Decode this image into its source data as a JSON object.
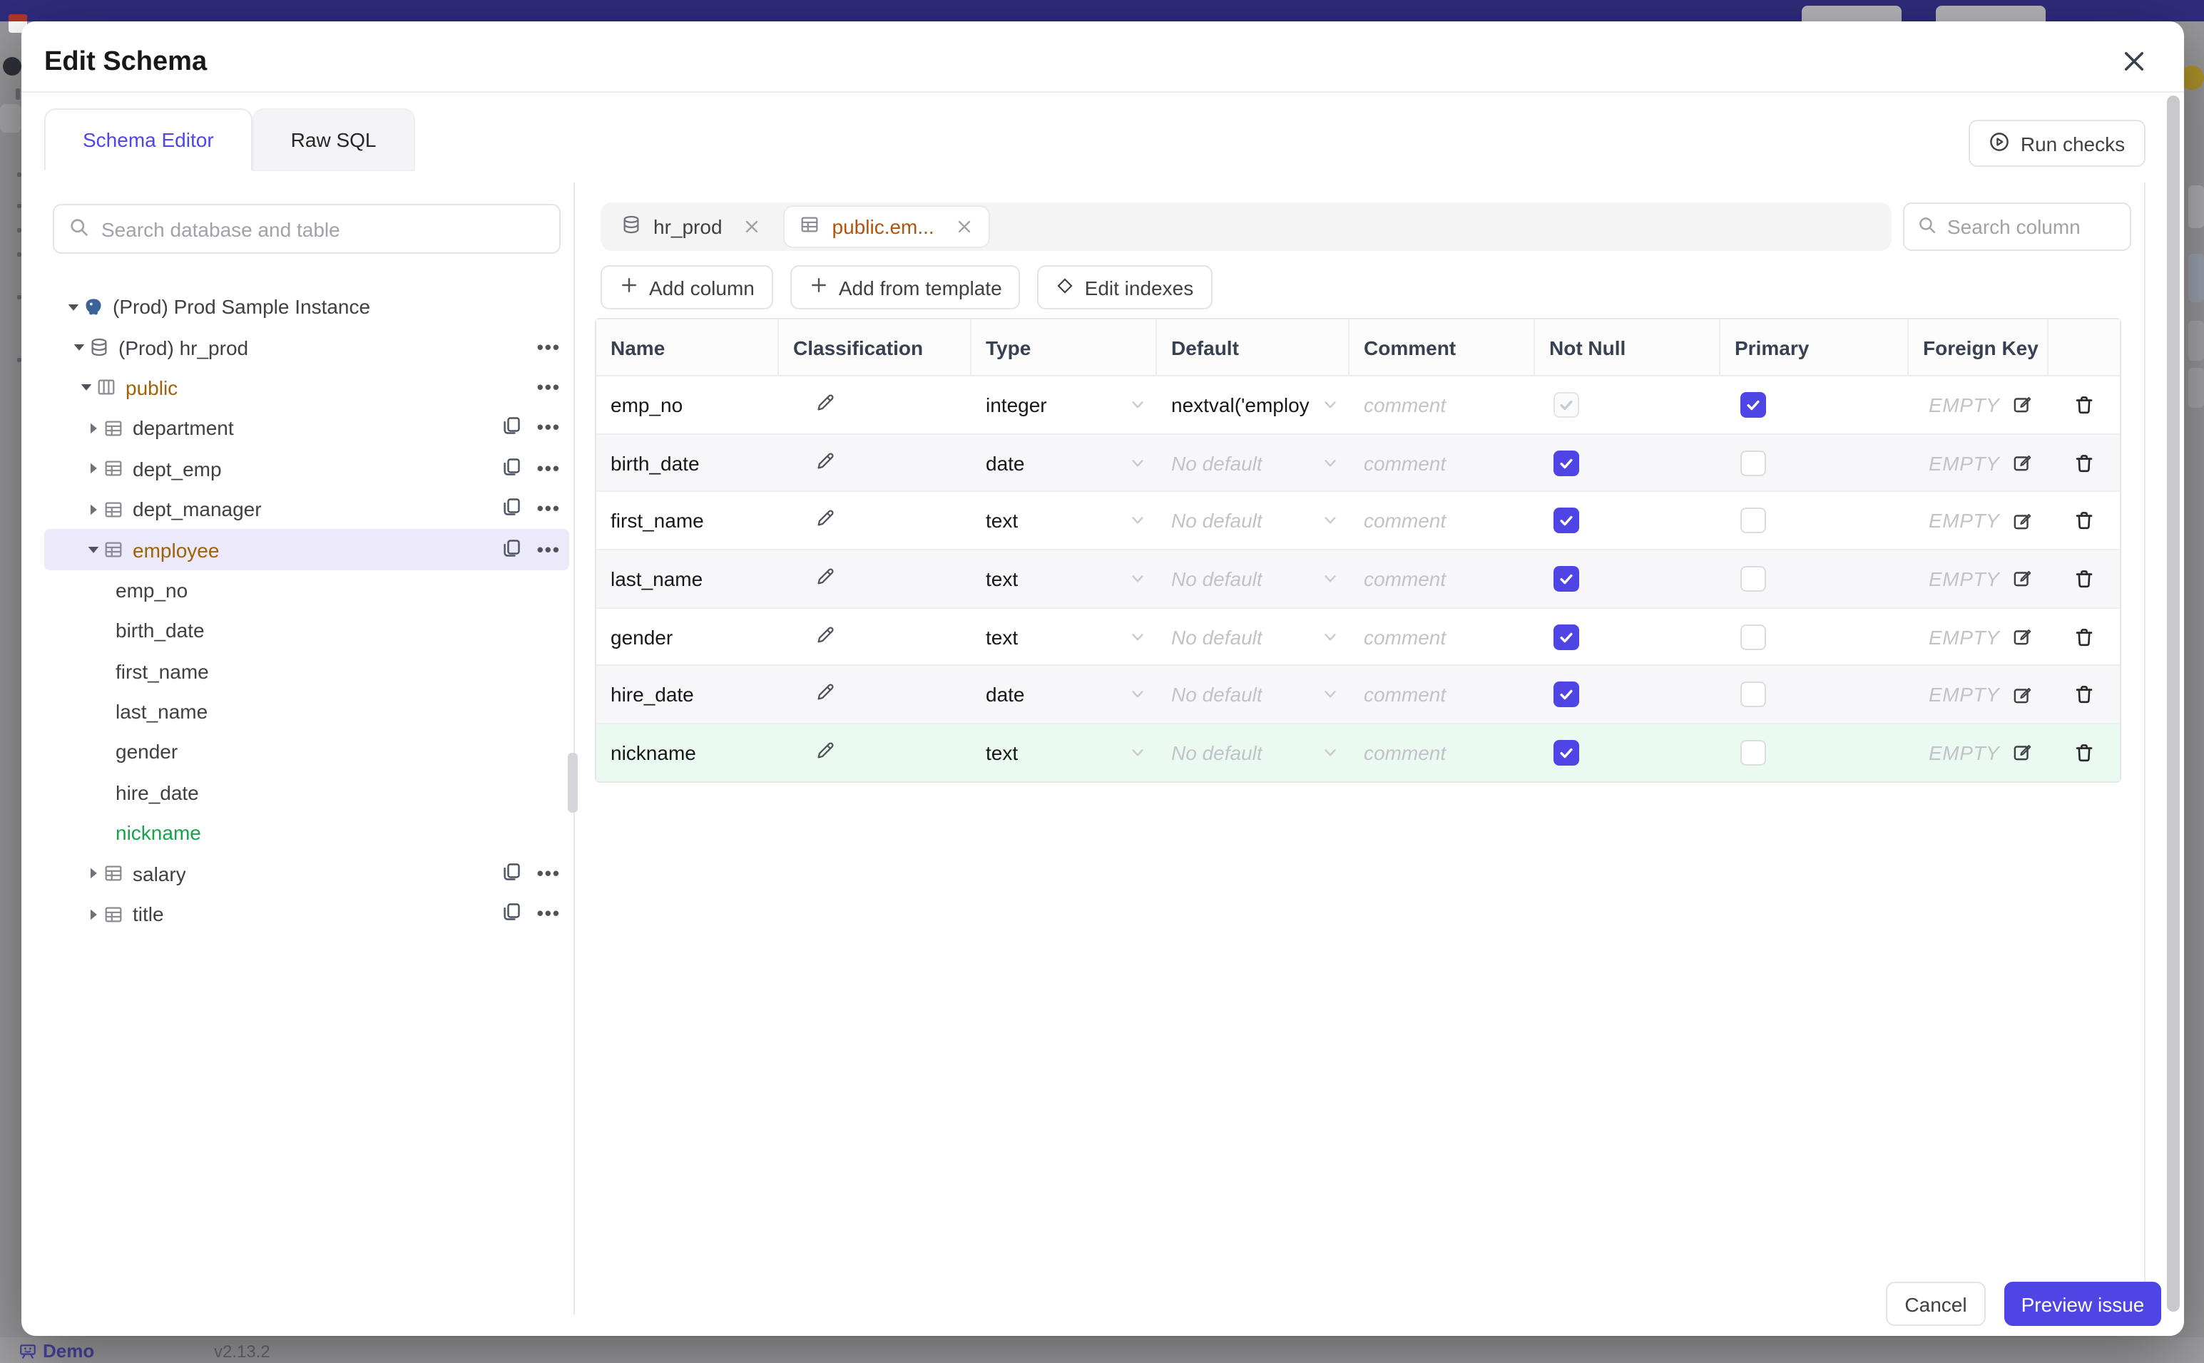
{
  "backdrop": {
    "demo_label": "Demo",
    "version": "v2.13.2"
  },
  "dialog": {
    "title": "Edit Schema",
    "close_icon": "close-icon",
    "tabs": [
      {
        "label": "Schema Editor",
        "active": true
      },
      {
        "label": "Raw SQL",
        "active": false
      }
    ],
    "run_checks_label": "Run checks",
    "sidebar": {
      "search_placeholder": "Search database and table",
      "tree": [
        {
          "level": 0,
          "caret": "down",
          "icon": "postgres",
          "label": "(Prod) Prod Sample Instance",
          "color": null,
          "selected": false,
          "copy": false,
          "menu": false
        },
        {
          "level": 1,
          "caret": "down",
          "icon": "database",
          "label": "(Prod) hr_prod",
          "color": null,
          "selected": false,
          "copy": false,
          "menu": true
        },
        {
          "level": 2,
          "caret": "down",
          "icon": "schema",
          "label": "public",
          "color": "amber",
          "selected": false,
          "copy": false,
          "menu": true
        },
        {
          "level": 3,
          "caret": "right",
          "icon": "table",
          "label": "department",
          "color": null,
          "selected": false,
          "copy": true,
          "menu": true
        },
        {
          "level": 3,
          "caret": "right",
          "icon": "table",
          "label": "dept_emp",
          "color": null,
          "selected": false,
          "copy": true,
          "menu": true
        },
        {
          "level": 3,
          "caret": "right",
          "icon": "table",
          "label": "dept_manager",
          "color": null,
          "selected": false,
          "copy": true,
          "menu": true
        },
        {
          "level": 3,
          "caret": "down",
          "icon": "table",
          "label": "employee",
          "color": "amber",
          "selected": true,
          "copy": true,
          "menu": true
        },
        {
          "level": 4,
          "caret": null,
          "icon": null,
          "label": "emp_no",
          "color": null,
          "selected": false,
          "copy": false,
          "menu": false
        },
        {
          "level": 4,
          "caret": null,
          "icon": null,
          "label": "birth_date",
          "color": null,
          "selected": false,
          "copy": false,
          "menu": false
        },
        {
          "level": 4,
          "caret": null,
          "icon": null,
          "label": "first_name",
          "color": null,
          "selected": false,
          "copy": false,
          "menu": false
        },
        {
          "level": 4,
          "caret": null,
          "icon": null,
          "label": "last_name",
          "color": null,
          "selected": false,
          "copy": false,
          "menu": false
        },
        {
          "level": 4,
          "caret": null,
          "icon": null,
          "label": "gender",
          "color": null,
          "selected": false,
          "copy": false,
          "menu": false
        },
        {
          "level": 4,
          "caret": null,
          "icon": null,
          "label": "hire_date",
          "color": null,
          "selected": false,
          "copy": false,
          "menu": false
        },
        {
          "level": 4,
          "caret": null,
          "icon": null,
          "label": "nickname",
          "color": "green",
          "selected": false,
          "copy": false,
          "menu": false
        },
        {
          "level": 3,
          "caret": "right",
          "icon": "table",
          "label": "salary",
          "color": null,
          "selected": false,
          "copy": true,
          "menu": true
        },
        {
          "level": 3,
          "caret": "right",
          "icon": "table",
          "label": "title",
          "color": null,
          "selected": false,
          "copy": true,
          "menu": true
        }
      ]
    },
    "editor": {
      "chips": [
        {
          "label": "hr_prod",
          "icon": "database",
          "active": false,
          "color": null
        },
        {
          "label": "public.em...",
          "icon": "table",
          "active": true,
          "color": "amber"
        }
      ],
      "column_search_placeholder": "Search column",
      "toolbar": [
        {
          "label": "Add column",
          "icon": "plus"
        },
        {
          "label": "Add from template",
          "icon": "plus"
        },
        {
          "label": "Edit indexes",
          "icon": "diamond"
        }
      ],
      "grid": {
        "headers": [
          "Name",
          "Classification",
          "Type",
          "Default",
          "Comment",
          "Not Null",
          "Primary",
          "Foreign Key",
          ""
        ],
        "comment_placeholder": "comment",
        "no_default_placeholder": "No default",
        "fk_empty_label": "EMPTY",
        "columns": [
          {
            "name": "emp_no",
            "type": "integer",
            "default": "nextval('employ",
            "default_is_placeholder": false,
            "not_null_checked": true,
            "not_null_disabled": true,
            "primary": true,
            "highlight": null
          },
          {
            "name": "birth_date",
            "type": "date",
            "default": "No default",
            "default_is_placeholder": true,
            "not_null_checked": true,
            "not_null_disabled": false,
            "primary": false,
            "highlight": null
          },
          {
            "name": "first_name",
            "type": "text",
            "default": "No default",
            "default_is_placeholder": true,
            "not_null_checked": true,
            "not_null_disabled": false,
            "primary": false,
            "highlight": null
          },
          {
            "name": "last_name",
            "type": "text",
            "default": "No default",
            "default_is_placeholder": true,
            "not_null_checked": true,
            "not_null_disabled": false,
            "primary": false,
            "highlight": null
          },
          {
            "name": "gender",
            "type": "text",
            "default": "No default",
            "default_is_placeholder": true,
            "not_null_checked": true,
            "not_null_disabled": false,
            "primary": false,
            "highlight": null
          },
          {
            "name": "hire_date",
            "type": "date",
            "default": "No default",
            "default_is_placeholder": true,
            "not_null_checked": true,
            "not_null_disabled": false,
            "primary": false,
            "highlight": null
          },
          {
            "name": "nickname",
            "type": "text",
            "default": "No default",
            "default_is_placeholder": true,
            "not_null_checked": true,
            "not_null_disabled": false,
            "primary": false,
            "highlight": "new"
          }
        ]
      }
    },
    "footer": {
      "cancel_label": "Cancel",
      "primary_label": "Preview issue"
    }
  },
  "colors": {
    "accent": "#4f45e4",
    "tab_active_text": "#4f46e5",
    "amber_text": "#a16207",
    "chip_amber_text": "#b45309",
    "green_text": "#16a34a",
    "new_row_bg": "#eafaf0",
    "selected_row_bg": "#eceafa",
    "topbar_bg": "#2f2c7d"
  }
}
